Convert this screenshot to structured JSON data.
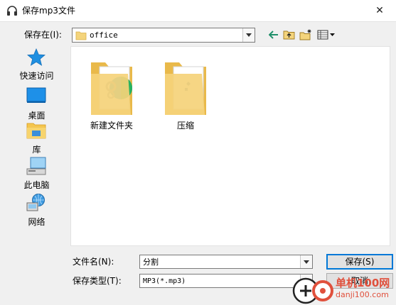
{
  "window": {
    "title": "保存mp3文件",
    "close_glyph": "✕"
  },
  "location": {
    "label": "保存在(I):",
    "current_folder": "office"
  },
  "sidebar": {
    "items": [
      {
        "label": "快速访问",
        "icon": "star-icon"
      },
      {
        "label": "桌面",
        "icon": "desktop-icon"
      },
      {
        "label": "库",
        "icon": "library-icon"
      },
      {
        "label": "此电脑",
        "icon": "computer-icon"
      },
      {
        "label": "网络",
        "icon": "network-icon"
      }
    ]
  },
  "files": [
    {
      "name": "新建文件夹",
      "icon": "folder-icon"
    },
    {
      "name": "压缩",
      "icon": "folder-icon"
    }
  ],
  "form": {
    "filename_label": "文件名(N):",
    "filename_value": "分割",
    "filetype_label": "保存类型(T):",
    "filetype_value": "MP3(*.mp3)"
  },
  "buttons": {
    "save": "保存(S)",
    "cancel": "取消"
  },
  "watermark": {
    "line1": "单机100网",
    "line2": "danji100.com"
  },
  "colors": {
    "folder": "#f4d47c",
    "accent": "#0078d7",
    "watermark": "#e0503c"
  }
}
